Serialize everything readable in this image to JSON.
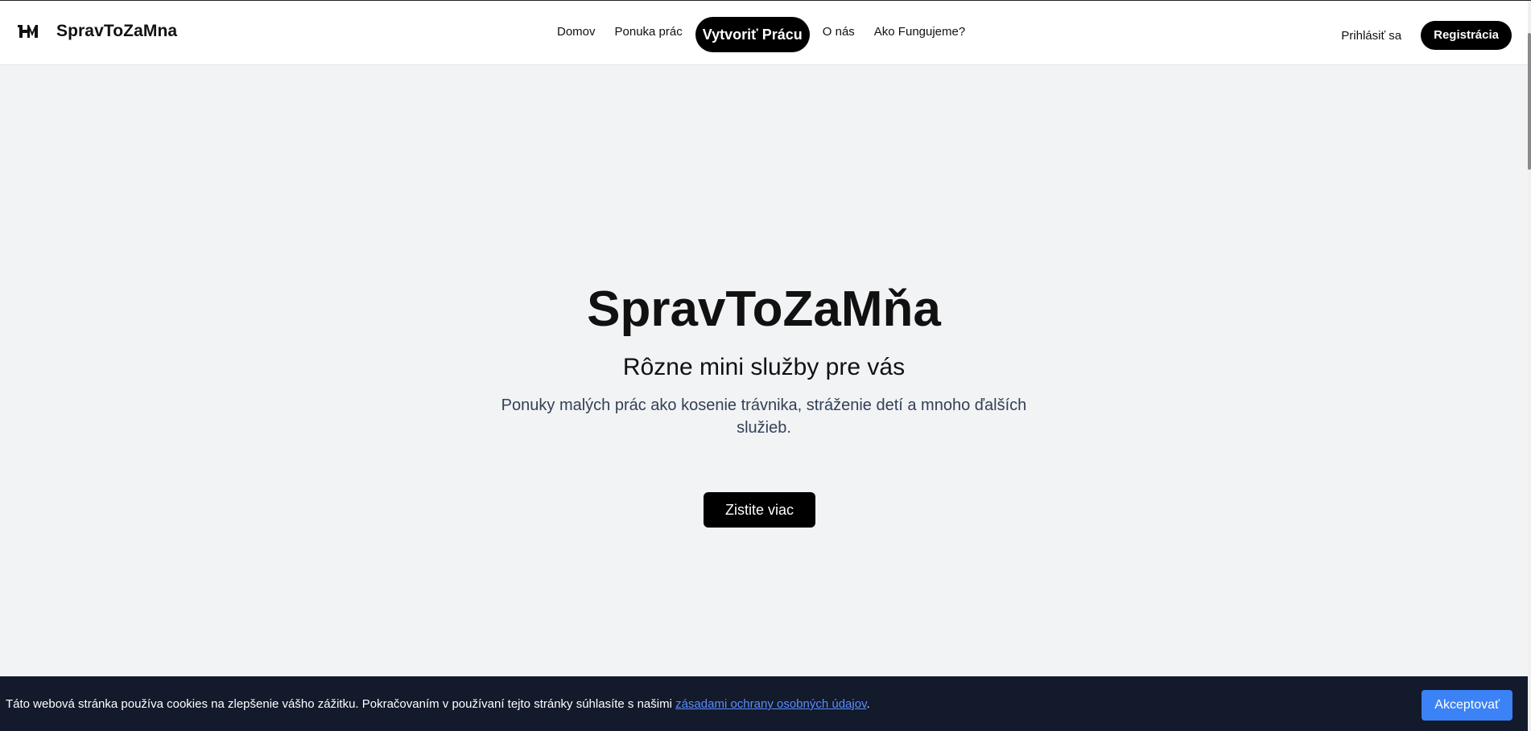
{
  "header": {
    "brand": "SpravToZaMna",
    "logo_icon": "hm-logo-icon",
    "nav": [
      {
        "label": "Domov"
      },
      {
        "label": "Ponuka prác"
      },
      {
        "label": "Vytvoriť Prácu"
      },
      {
        "label": "O nás"
      },
      {
        "label": "Ako Fungujeme?"
      }
    ],
    "login_label": "Prihlásiť sa",
    "register_label": "Registrácia"
  },
  "hero": {
    "title": "SpravToZaMňa",
    "subtitle": "Rôzne mini služby pre vás",
    "description": "Ponuky malých prác ako kosenie trávnika, stráženie detí a mnoho ďalších služieb.",
    "button_label": "Zistite viac"
  },
  "cookie": {
    "text_before": "Táto webová stránka používa cookies na zlepšenie vášho zážitku. Pokračovaním v používaní tejto stránky súhlasíte s našimi ",
    "link_text": "zásadami ochrany osobných údajov",
    "text_after": ".",
    "accept_label": "Akceptovať"
  },
  "colors": {
    "page_bg": "#f2f3f5",
    "primary_black": "#000000",
    "cookie_bg": "#121a2b",
    "cookie_link": "#5b8dff",
    "accept_button": "#3b82f6"
  }
}
